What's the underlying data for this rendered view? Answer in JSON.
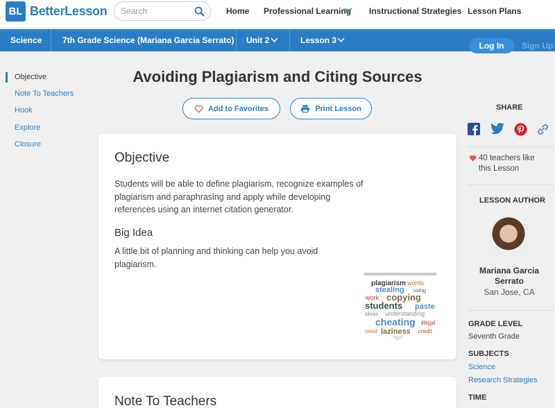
{
  "header": {
    "logo_mark": "BL",
    "logo_text": "BetterLesson",
    "search_placeholder": "Search",
    "nav": [
      "Home",
      "Professional Learning",
      "Instructional Strategies",
      "Lesson Plans"
    ]
  },
  "subnav": {
    "subject": "Science",
    "course": "7th Grade Science (Mariana Garcia Serrato)",
    "unit": "Unit 2",
    "lesson": "Lesson 3",
    "login": "Log In",
    "signup": "Sign Up"
  },
  "sidebar": {
    "items": [
      "Objective",
      "Note To Teachers",
      "Hook",
      "Explore",
      "Closure"
    ]
  },
  "lesson": {
    "title": "Avoiding Plagiarism and Citing Sources",
    "favorites_label": "Add to Favorites",
    "print_label": "Print Lesson"
  },
  "objective_card": {
    "heading": "Objective",
    "text": "Students will be able to define plagiarism, recognize examples of plagiarism and paraphrasing and apply while developing references using an internet citation generator.",
    "big_idea_heading": "Big Idea",
    "big_idea_text": "A little bit of planning and thinking can help you avoid plagiarism."
  },
  "next_card": {
    "heading": "Note To Teachers"
  },
  "right_panel": {
    "share_label": "SHARE",
    "likes_text": "40 teachers like this Lesson",
    "author_label": "LESSON AUTHOR",
    "author_name": "Mariana Garcia Serrato",
    "author_location": "San Jose, CA",
    "grade_label": "GRADE LEVEL",
    "grade_value": "Seventh Grade",
    "subjects_label": "SUBJECTS",
    "subjects": [
      "Science",
      "Research Strategies"
    ],
    "time_label": "TIME"
  },
  "colors": {
    "brand": "#2a7dc4",
    "heart": "#e05a5a"
  }
}
